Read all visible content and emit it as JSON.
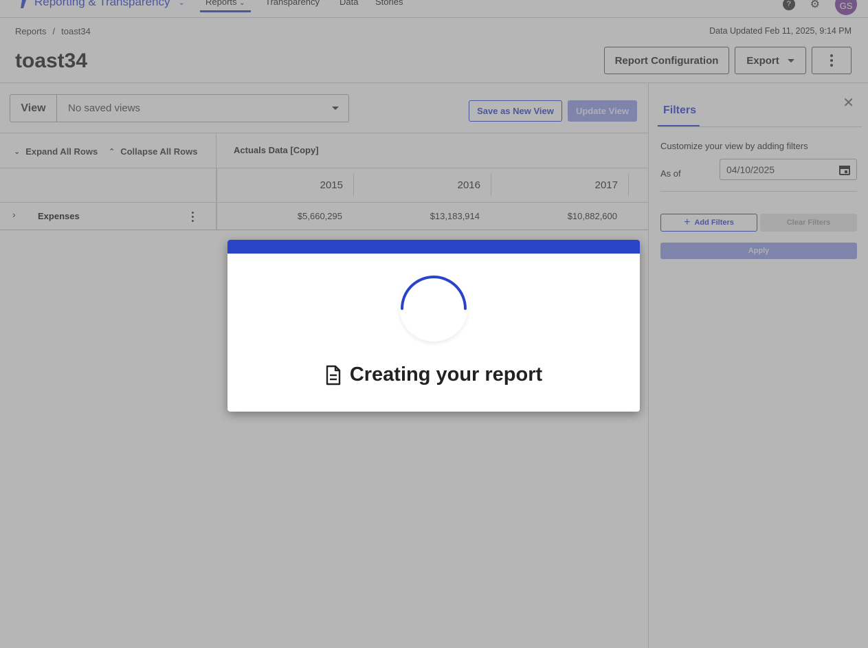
{
  "nav": {
    "brand": "Reporting & Transparency",
    "tabs": [
      "Reports",
      "Transparency",
      "Data",
      "Stories"
    ],
    "active_tab": "Reports",
    "avatar_initials": "GS",
    "accent_color": "#2a3fd1"
  },
  "header": {
    "breadcrumb": [
      "Reports",
      "toast34"
    ],
    "breadcrumb_separator": "/",
    "data_updated": "Data Updated Feb 11, 2025, 9:14 PM",
    "title": "toast34",
    "buttons": {
      "report_configuration": "Report Configuration",
      "export": "Export"
    }
  },
  "view_bar": {
    "label": "View",
    "selected": "No saved views",
    "save_new": "Save as New View",
    "update": "Update View"
  },
  "grid": {
    "expand_all": "Expand All Rows",
    "collapse_all": "Collapse All Rows",
    "series_name": "Actuals Data [Copy]",
    "years": [
      "2015",
      "2016",
      "2017"
    ],
    "rows": [
      {
        "label": "Expenses",
        "values": [
          "$5,660,295",
          "$13,183,914",
          "$10,882,600"
        ]
      }
    ]
  },
  "filters": {
    "tab": "Filters",
    "description": "Customize your view by adding filters",
    "as_of_label": "As of",
    "as_of_value": "04/10/2025",
    "add_filters": "Add Filters",
    "clear_filters": "Clear Filters",
    "apply": "Apply"
  },
  "modal": {
    "message": "Creating your report",
    "bar_color": "#2a44c8"
  }
}
